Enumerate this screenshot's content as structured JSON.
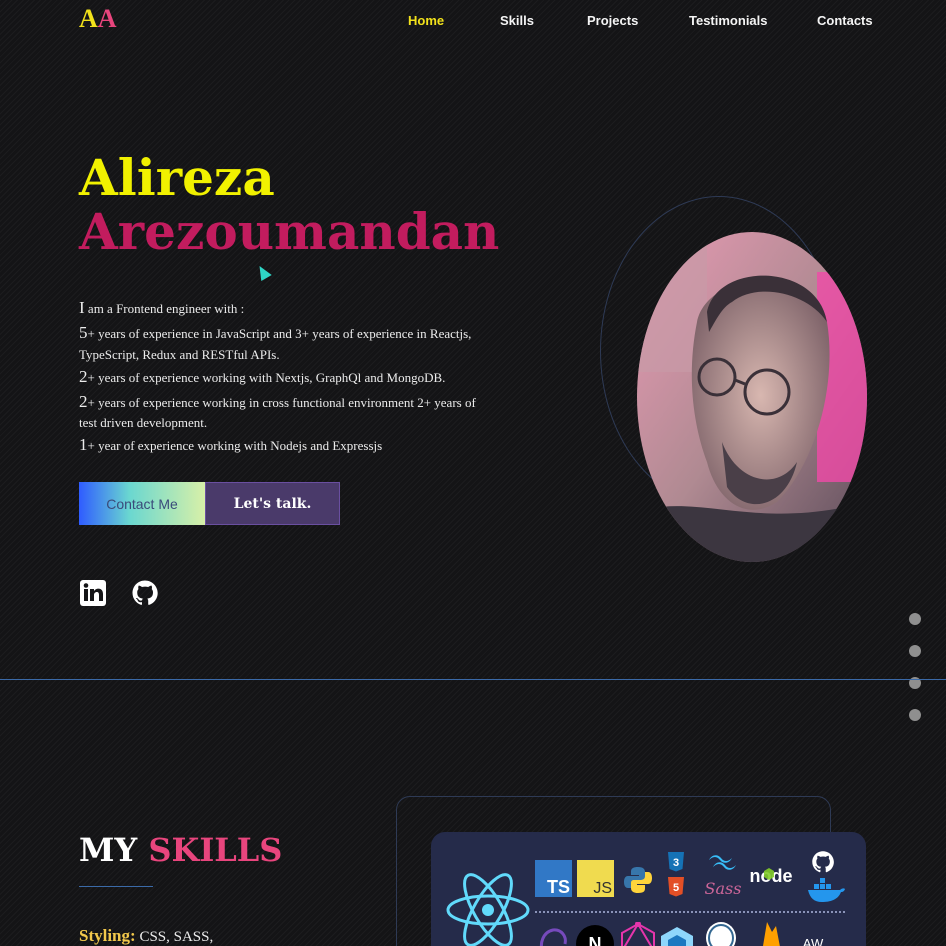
{
  "nav": {
    "logo_first": "A",
    "logo_second": "A",
    "items": [
      {
        "label": "Home",
        "active": true
      },
      {
        "label": "Skills",
        "active": false
      },
      {
        "label": "Projects",
        "active": false
      },
      {
        "label": "Testimonials",
        "active": false
      },
      {
        "label": "Contacts",
        "active": false
      }
    ]
  },
  "hero": {
    "first_name": "Alireza",
    "last_name": "Arezoumandan",
    "bio": [
      {
        "lead": "I",
        "rest": " am a Frontend engineer with :"
      },
      {
        "lead": "5",
        "rest": "+ years of experience in JavaScript and 3+ years of experience in Reactjs,"
      },
      {
        "lead": "",
        "rest": "TypeScript, Redux and RESTful APIs."
      },
      {
        "lead": "2",
        "rest": "+ years of experience working with Nextjs, GraphQl and MongoDB."
      },
      {
        "lead": "2",
        "rest": "+ years of experience working in cross functional environment 2+ years of"
      },
      {
        "lead": "",
        "rest": "test driven development."
      },
      {
        "lead": "1",
        "rest": "+ year of experience working with Nodejs and Expressjs"
      }
    ],
    "contact_button": "Contact Me",
    "talk_button": "Let's talk.",
    "social_icons": [
      "linkedin-icon",
      "github-icon"
    ]
  },
  "side_dots": 4,
  "skills": {
    "title_word1": "MY",
    "title_word2": "SKILLS",
    "styling_label": "Styling:",
    "styling_value": " CSS, SASS,",
    "icons": [
      "react-icon",
      "typescript-icon",
      "javascript-icon",
      "python-icon",
      "css3-icon",
      "html5-icon",
      "tailwind-icon",
      "sass-icon",
      "nodejs-icon",
      "github-icon",
      "docker-icon",
      "redux-icon",
      "nextjs-icon",
      "graphql-icon",
      "webpack-icon",
      "postgresql-icon",
      "firebase-icon",
      "aws-icon"
    ]
  },
  "colors": {
    "accent_yellow": "#f1f100",
    "accent_pink": "#c21c5e",
    "nav_active": "#f2e21b",
    "divider": "#3b6aa8"
  }
}
